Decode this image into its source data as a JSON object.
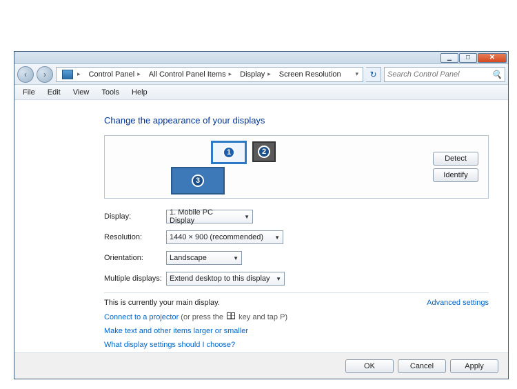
{
  "titlebar": {
    "min": "▁",
    "max": "☐",
    "close": "✕"
  },
  "nav": {
    "back": "‹",
    "forward": "›"
  },
  "breadcrumb": {
    "root": "Control Panel",
    "items": "All Control Panel Items",
    "display": "Display",
    "current": "Screen Resolution"
  },
  "search": {
    "placeholder": "Search Control Panel"
  },
  "menu": {
    "file": "File",
    "edit": "Edit",
    "view": "View",
    "tools": "Tools",
    "help": "Help"
  },
  "heading": "Change the appearance of your displays",
  "monitors": {
    "m1": "1",
    "m2": "2",
    "m3": "3"
  },
  "buttons": {
    "detect": "Detect",
    "identify": "Identify"
  },
  "form": {
    "display_label": "Display:",
    "display_value": "1. Mobile PC Display",
    "resolution_label": "Resolution:",
    "resolution_value": "1440 × 900 (recommended)",
    "orientation_label": "Orientation:",
    "orientation_value": "Landscape",
    "multiple_label": "Multiple displays:",
    "multiple_value": "Extend desktop to this display"
  },
  "status": "This is currently your main display.",
  "advanced": "Advanced settings",
  "projector_link": "Connect to a projector",
  "projector_tail": " (or press the ",
  "projector_tail2": " key and tap P)",
  "larger_link": "Make text and other items larger or smaller",
  "which_link": "What display settings should I choose?",
  "footer": {
    "ok": "OK",
    "cancel": "Cancel",
    "apply": "Apply"
  }
}
